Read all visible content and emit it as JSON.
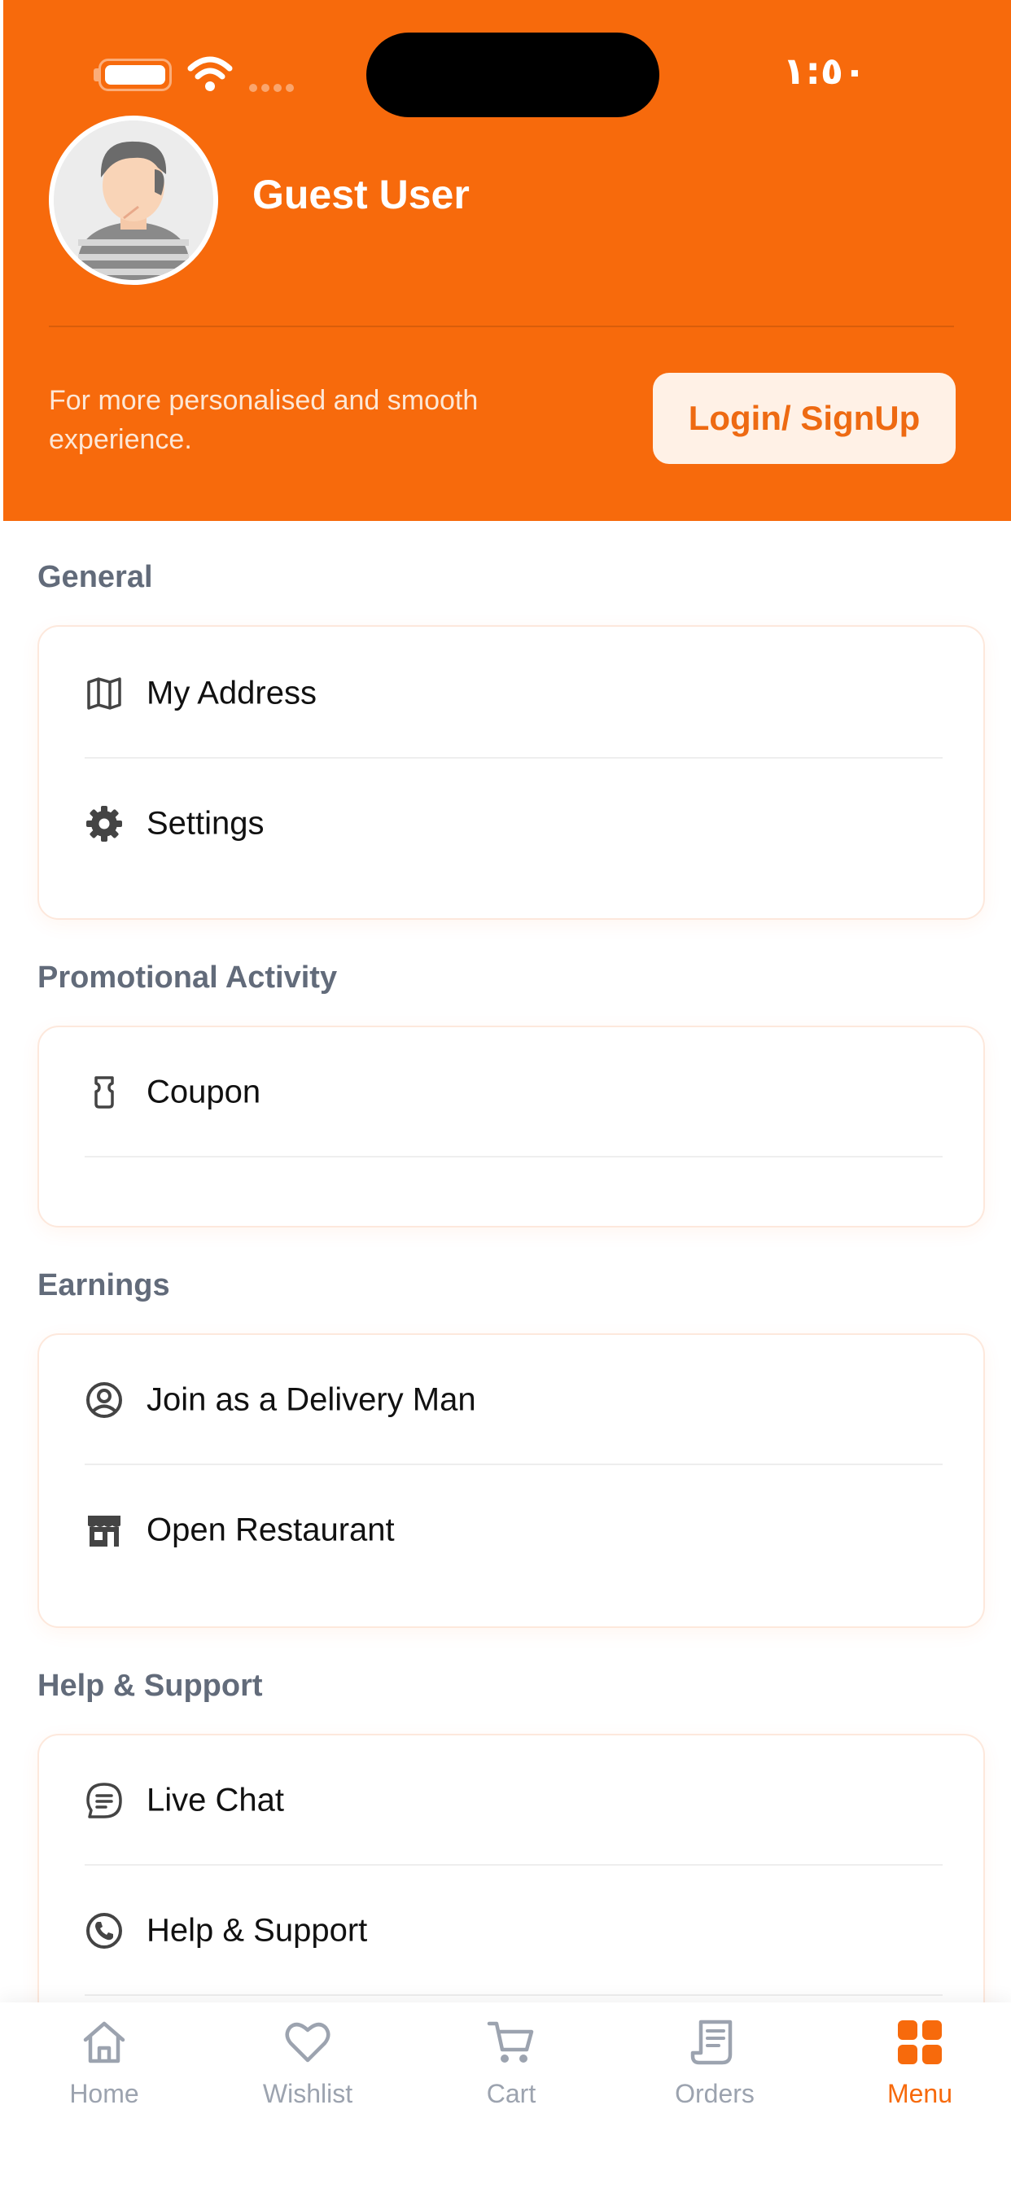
{
  "status_bar": {
    "time": "١:٥٠"
  },
  "profile": {
    "name": "Guest User",
    "promo_text": "For more personalised and smooth experience.",
    "login_button": "Login/ SignUp"
  },
  "colors": {
    "accent": "#F76A0C",
    "section_title": "#626B7A"
  },
  "sections": [
    {
      "title": "General",
      "items": [
        {
          "label": "My Address",
          "icon": "map-icon"
        },
        {
          "label": "Settings",
          "icon": "gear-icon"
        }
      ]
    },
    {
      "title": "Promotional Activity",
      "items": [
        {
          "label": "Coupon",
          "icon": "coupon-icon"
        }
      ]
    },
    {
      "title": "Earnings",
      "items": [
        {
          "label": "Join as a Delivery Man",
          "icon": "user-circle-icon"
        },
        {
          "label": "Open Restaurant",
          "icon": "store-icon"
        }
      ]
    },
    {
      "title": "Help & Support",
      "items": [
        {
          "label": "Live Chat",
          "icon": "chat-icon"
        },
        {
          "label": "Help & Support",
          "icon": "phone-icon"
        }
      ]
    }
  ],
  "nav": [
    {
      "label": "Home",
      "icon": "home-icon",
      "active": false
    },
    {
      "label": "Wishlist",
      "icon": "heart-icon",
      "active": false
    },
    {
      "label": "Cart",
      "icon": "cart-icon",
      "active": false
    },
    {
      "label": "Orders",
      "icon": "receipt-icon",
      "active": false
    },
    {
      "label": "Menu",
      "icon": "grid-icon",
      "active": true
    }
  ]
}
